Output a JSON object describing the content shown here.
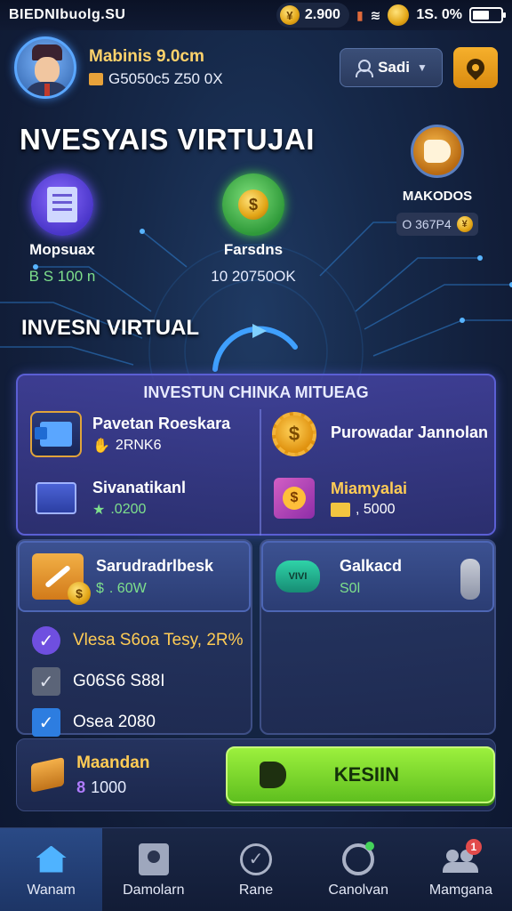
{
  "status_bar": {
    "carrier": "BIEDNIbuolg.SU",
    "coin_symbol": "¥",
    "balance": "2.900",
    "battery": "1S. 0%",
    "battery_level": 0.6
  },
  "profile": {
    "name": "Mabinis 9.0cm",
    "subtitle": "G5050c5 Z50 0X",
    "user_button_label": "Sadi"
  },
  "header": {
    "title": "NVESYAIS VIRTUJAI"
  },
  "stats": [
    {
      "label": "Mopsuax",
      "value": "B S 100 n",
      "icon": "document-magnifier-icon"
    },
    {
      "label": "Farsdns",
      "value": "10 20750OK",
      "icon": "money-coins-icon"
    },
    {
      "label": "MAKODOS",
      "value": "O 367P4",
      "icon": "hand-coin-icon"
    }
  ],
  "section_title": "INVESN VIRTUAL",
  "invest_panel": {
    "title": "INVESTUN CHINKA MITUEAG",
    "items": [
      {
        "title": "Pavetan Roeskara",
        "amount": "2RNK6",
        "icon": "chart-screen-icon"
      },
      {
        "title": "Purowadar Jannolan",
        "amount": "",
        "icon": "gear-coin-icon"
      },
      {
        "title": "Sivanatikanl",
        "amount": ".0200",
        "icon": "folder-icon"
      },
      {
        "title": "Miamyalai",
        "amount": ", 5000",
        "icon": "gift-box-icon"
      }
    ]
  },
  "cards": [
    {
      "title": "Sarudradrlbesk",
      "amount": ". 60W",
      "icon": "tool-coin-icon"
    },
    {
      "title": "Galkacd",
      "amount": "S0l",
      "icon": "badge-icon"
    }
  ],
  "checklist": [
    {
      "label": "Vlesa S6oa Tesy, 2R%",
      "icon": "check-circle-icon"
    },
    {
      "label": "G06S6 S88I",
      "icon": "check-box-icon"
    },
    {
      "label": "Osea 2080",
      "icon": "check-box-icon"
    }
  ],
  "bottom": {
    "title": "Maandan",
    "amount_symbol": "8",
    "amount": "1000",
    "cta_label": "KESIIN"
  },
  "nav": [
    {
      "label": "Wanam",
      "icon": "home-icon",
      "active": true
    },
    {
      "label": "Damolarn",
      "icon": "dashboard-icon",
      "active": false
    },
    {
      "label": "Rane",
      "icon": "check-icon",
      "active": false
    },
    {
      "label": "Canolvan",
      "icon": "chat-icon",
      "active": false
    },
    {
      "label": "Mamgana",
      "icon": "people-icon",
      "active": false,
      "badge": "1"
    }
  ]
}
